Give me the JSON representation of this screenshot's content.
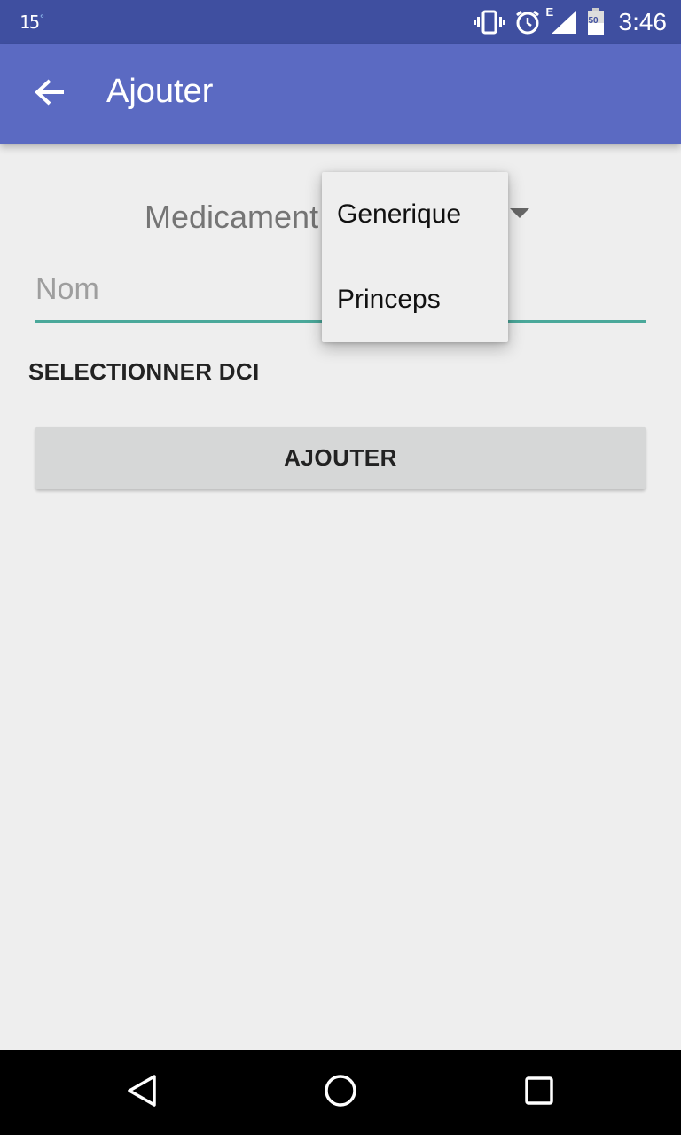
{
  "status_bar": {
    "temperature": "15",
    "temperature_unit": "°",
    "network_type": "E",
    "battery_level": "50",
    "time": "3:46",
    "icons": [
      "vibrate-icon",
      "alarm-icon",
      "signal-icon",
      "battery-icon"
    ]
  },
  "app_bar": {
    "title": "Ajouter",
    "back_icon": "arrow-back-icon",
    "color": "#5b6ac2"
  },
  "form": {
    "type_spinner": {
      "selected": "Medicament",
      "options": [
        "Generique",
        "Princeps"
      ]
    },
    "name_field": {
      "value": "",
      "placeholder": "Nom"
    },
    "select_dci_label": "SELECTIONNER DCI",
    "submit_label": "AJOUTER"
  },
  "nav_bar": {
    "buttons": [
      "back-triangle-icon",
      "home-circle-icon",
      "recents-square-icon"
    ]
  },
  "colors": {
    "status_bar": "#3f4fa0",
    "accent": "#4aa89a",
    "background": "#eeeeee"
  }
}
